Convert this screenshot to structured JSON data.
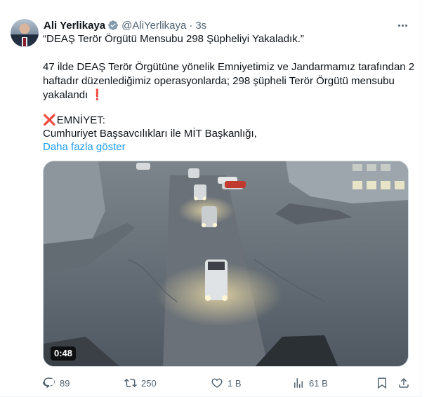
{
  "tweet": {
    "author": {
      "name": "Ali Yerlikaya",
      "handle": "@AliYerlikaya",
      "separator": "·",
      "time": "3s"
    },
    "lines": {
      "line1": "“DEAŞ Terör Örgütü Mensubu 298 Şüpheliyi Yakaladık.”",
      "line2": "47 ilde DEAŞ Terör Örgütüne yönelik Emniyetimiz ve Jandarmamız tarafından 2",
      "line3": "haftadır düzenlediğimiz operasyonlarda; 298 şüpheli Terör Örgütü mensubu",
      "line4": "yakalandı",
      "line4_mark": "❗",
      "line5_mark": "❌",
      "line5": "EMNİYET:",
      "line6": "Cumhuriyet Başsavcılıkları ile MİT Başkanlığı,"
    },
    "show_more": "Daha fazla göster",
    "video": {
      "duration": "0:48"
    },
    "stats": {
      "replies": "89",
      "reposts": "250",
      "likes": "1 B",
      "views": "61 B"
    }
  },
  "colors": {
    "accent": "#1d9bf0",
    "text": "#0f1419",
    "secondary": "#536471",
    "verified": "#829aab"
  },
  "icons": [
    "verified-badge-icon",
    "more-icon",
    "reply-icon",
    "repost-icon",
    "like-icon",
    "views-icon",
    "bookmark-icon",
    "share-icon"
  ]
}
